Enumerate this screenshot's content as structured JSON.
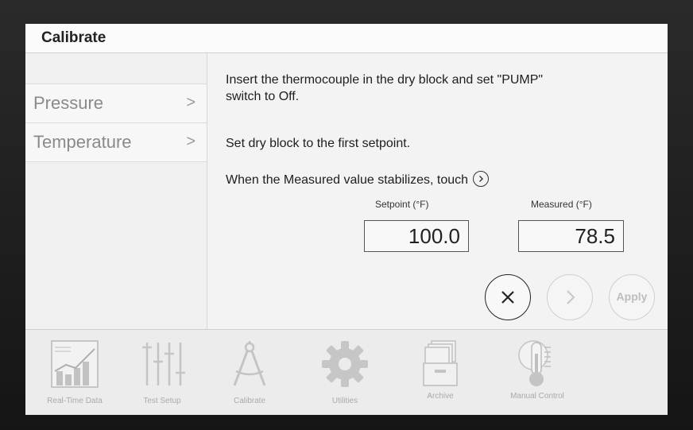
{
  "title": "Calibrate",
  "sidebar": {
    "items": [
      {
        "label": "Pressure",
        "chevron": ">"
      },
      {
        "label": "Temperature",
        "chevron": ">"
      }
    ]
  },
  "content": {
    "instruction1": "Insert the thermocouple in the dry block and set \"PUMP\" switch to Off.",
    "instruction2": "Set dry block to the first setpoint.",
    "instruction3": "When the Measured value stabilizes, touch",
    "setpoint": {
      "label": "Setpoint (°F)",
      "value": "100.0"
    },
    "measured": {
      "label": "Measured (°F)",
      "value": "78.5"
    }
  },
  "buttons": {
    "cancel_icon": "x-icon",
    "next_icon": "chevron-right-icon",
    "apply_label": "Apply"
  },
  "nav": [
    {
      "label": "Real-Time Data",
      "icon": "chart-icon"
    },
    {
      "label": "Test Setup",
      "icon": "sliders-icon"
    },
    {
      "label": "Calibrate",
      "icon": "compass-icon"
    },
    {
      "label": "Utilities",
      "icon": "gear-icon"
    },
    {
      "label": "Archive",
      "icon": "archive-icon"
    },
    {
      "label": "Manual Control",
      "icon": "thermometer-icon"
    }
  ],
  "colors": {
    "screen_bg": "#f3f3f3",
    "text": "#1e1e1e",
    "disabled": "#bdbdbd",
    "nav_icon": "#c4c4c4"
  }
}
